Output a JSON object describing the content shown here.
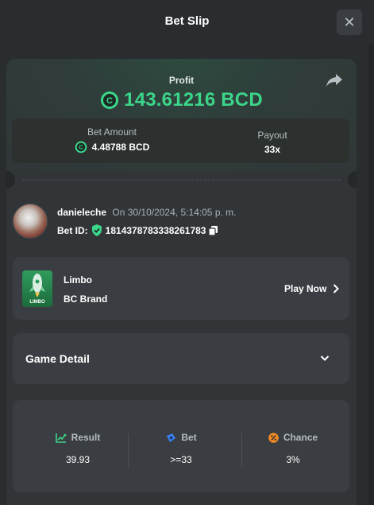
{
  "header": {
    "title": "Bet Slip",
    "close_label": "✕"
  },
  "profit": {
    "label": "Profit",
    "value": "143.61216 BCD",
    "color": "#3bd68a"
  },
  "bet_summary": {
    "bet_amount_label": "Bet Amount",
    "bet_amount_value": "4.48788 BCD",
    "payout_label": "Payout",
    "payout_value": "33x"
  },
  "user": {
    "username": "danieleche",
    "date_text": "On 30/10/2024, 5:14:05 p. m.",
    "bet_id_label": "Bet ID:",
    "bet_id": "1814378783338261783"
  },
  "game": {
    "name": "Limbo",
    "brand": "BC Brand",
    "play_label": "Play Now",
    "thumb_text": "LIMBO"
  },
  "game_detail": {
    "title": "Game Detail"
  },
  "stats": [
    {
      "label": "Result",
      "value": "39.93",
      "icon": "chart-up-icon",
      "color": "#3bd68a"
    },
    {
      "label": "Bet",
      "value": ">=33",
      "icon": "chip-icon",
      "color": "#3b82f6"
    },
    {
      "label": "Chance",
      "value": "3%",
      "icon": "percent-icon",
      "color": "#f08a24"
    }
  ]
}
